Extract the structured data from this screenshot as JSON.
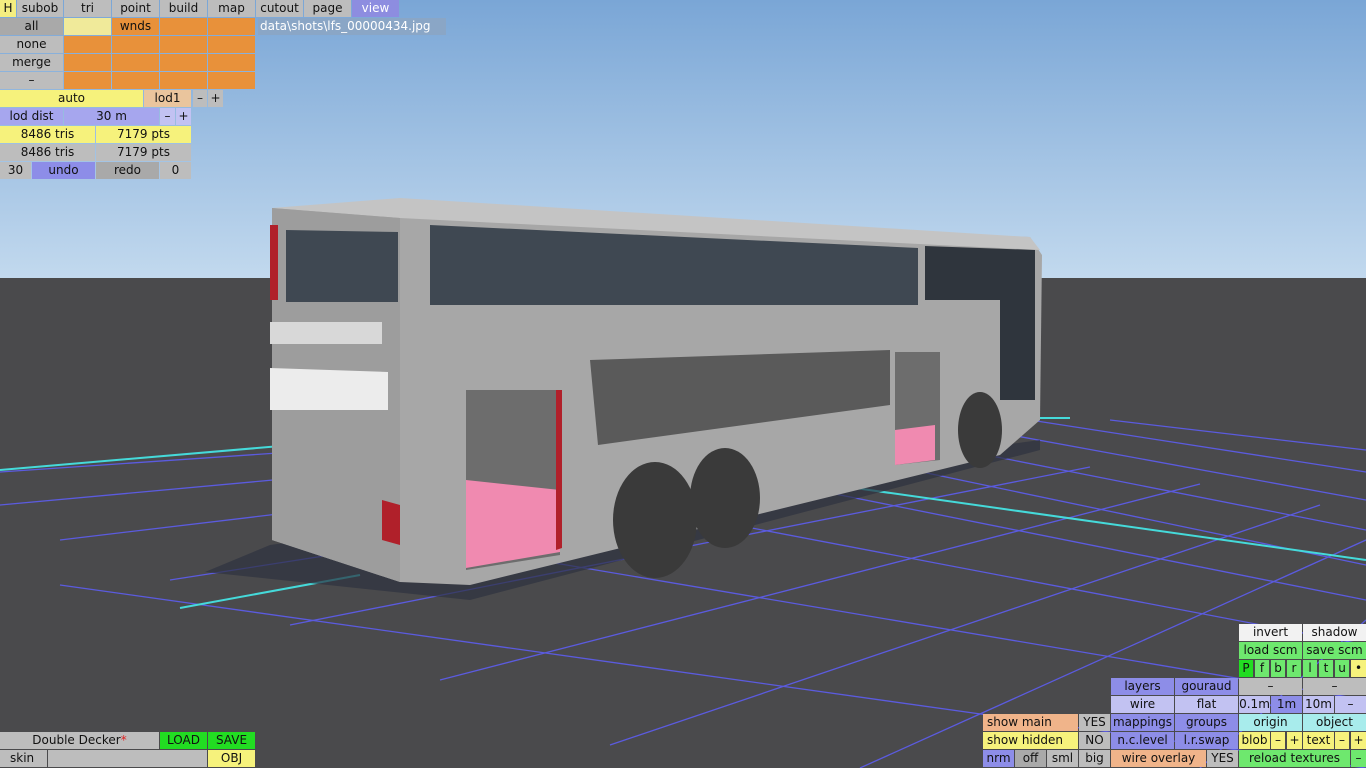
{
  "path_label": "data\\shots\\lfs_00000434.jpg",
  "top_tabs": {
    "h": "H",
    "subob": "subob",
    "tri": "tri",
    "point": "point",
    "build": "build",
    "map": "map",
    "cutout": "cutout",
    "page": "page",
    "view": "view"
  },
  "left_panel": {
    "all": "all",
    "none": "none",
    "merge": "merge",
    "minus": "–",
    "wnds": "wnds",
    "auto": "auto",
    "lod1": "lod1",
    "lod_minus": "–",
    "lod_plus": "+",
    "lod_dist": "lod dist",
    "lod_dist_value": "30 m",
    "dist_minus": "–",
    "dist_plus": "+",
    "tris1": "8486 tris",
    "pts1": "7179 pts",
    "tris2": "8486 tris",
    "pts2": "7179 pts",
    "undo_count": "30",
    "undo": "undo",
    "redo": "redo",
    "redo_count": "0"
  },
  "bottom_left": {
    "name": "Double Decker",
    "modified_mark": "*",
    "load": "LOAD",
    "save": "SAVE",
    "skin": "skin",
    "obj": "OBJ"
  },
  "bottom_right": {
    "invert": "invert",
    "shadow": "shadow",
    "load_scm": "load scm",
    "save_scm": "save scm",
    "flags": [
      "P",
      "f",
      "b",
      "r",
      "l",
      "t",
      "u",
      "•"
    ],
    "dash1": "–",
    "dash2": "–",
    "layers": "layers",
    "gouraud": "gouraud",
    "wire": "wire",
    "flat": "flat",
    "s01": "0.1m",
    "s1": "1m",
    "s10": "10m",
    "sminus": "–",
    "show_main": "show main",
    "yes1": "YES",
    "mappings": "mappings",
    "groups": "groups",
    "origin": "origin",
    "object": "object",
    "show_hidden": "show hidden",
    "no": "NO",
    "nclevel": "n.c.level",
    "lrswap": "l.r.swap",
    "blob": "blob",
    "bminus": "–",
    "bplus": "+",
    "text": "text",
    "tminus": "–",
    "tplus": "+",
    "nrm": "nrm",
    "off": "off",
    "sml": "sml",
    "big": "big",
    "wire_overlay": "wire overlay",
    "yes2": "YES",
    "reload_textures": "reload textures",
    "rminus": "–"
  },
  "colors": {
    "sky_top": "#7aa6d6",
    "sky_bottom": "#c2d9ee",
    "ground": "#4a4a4c",
    "grid": "#5d5df0",
    "axis": "#45dada",
    "bus_body": "#a7a7a7",
    "interior_floor": "#f08ab0"
  }
}
